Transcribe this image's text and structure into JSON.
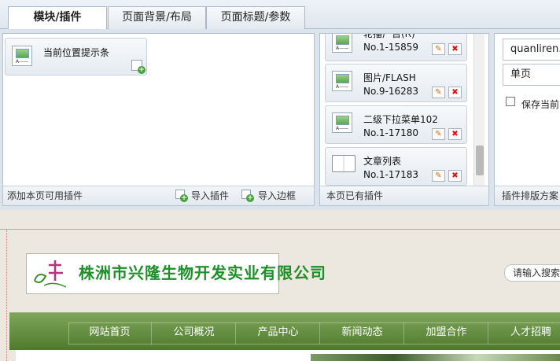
{
  "tabs": [
    {
      "label": "模块/插件",
      "active": true
    },
    {
      "label": "页面背景/布局",
      "active": false
    },
    {
      "label": "页面标题/参数",
      "active": false
    }
  ],
  "available_panel": {
    "item_label": "当前位置提示条",
    "footer_label": "添加本页可用插件",
    "import_plugin_label": "导入插件",
    "import_border_label": "导入边框"
  },
  "page_plugins_panel": {
    "footer_label": "本页已有插件",
    "items": [
      {
        "name": "轮播广告(R)",
        "no": "No.1-15859",
        "icon": "image-icon"
      },
      {
        "name": "图片/FLASH",
        "no": "No.9-16283",
        "icon": "image-icon"
      },
      {
        "name": "二级下拉菜单102",
        "no": "No.1-17180",
        "icon": "image-icon"
      },
      {
        "name": "文章列表",
        "no": "No.1-17183",
        "icon": "book-icon"
      }
    ]
  },
  "layout_panel": {
    "input_value": "quanliren.n",
    "select_value": "单页",
    "checkbox_label": "保存当前",
    "footer_label": "插件排版方案"
  },
  "site": {
    "company_name": "株洲市兴隆生物开发实业有限公司",
    "search_placeholder": "请输入搜索",
    "nav": [
      "网站首页",
      "公司概况",
      "产品中心",
      "新闻动态",
      "加盟合作",
      "人才招聘"
    ]
  },
  "colors": {
    "nav_green": "#5e8a3b",
    "company_green": "#1f8f2a",
    "panel_bg": "#dbe4ed"
  }
}
